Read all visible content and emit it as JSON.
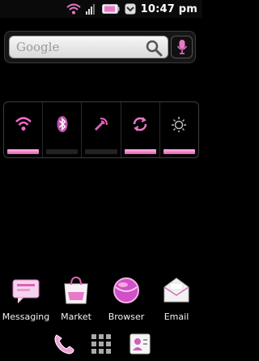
{
  "status_bar": {
    "time": "10:47 pm",
    "icons": [
      "wifi-icon",
      "signal-icon",
      "battery-icon",
      "notification-icon"
    ]
  },
  "search_widget": {
    "placeholder": "Google",
    "search_icon": "magnifier-icon",
    "voice_icon": "microphone-icon"
  },
  "power_widget": {
    "toggles": [
      {
        "name": "wifi",
        "icon": "wifi-icon",
        "on": true
      },
      {
        "name": "bluetooth",
        "icon": "bluetooth-icon",
        "on": false
      },
      {
        "name": "gps",
        "icon": "gps-icon",
        "on": false
      },
      {
        "name": "sync",
        "icon": "sync-icon",
        "on": true
      },
      {
        "name": "brightness",
        "icon": "brightness-icon",
        "on": true
      }
    ]
  },
  "apps": [
    {
      "label": "Messaging",
      "icon": "messaging-icon"
    },
    {
      "label": "Market",
      "icon": "market-icon"
    },
    {
      "label": "Browser",
      "icon": "browser-icon"
    },
    {
      "label": "Email",
      "icon": "email-icon"
    }
  ],
  "dock": [
    {
      "icon": "phone-icon"
    },
    {
      "icon": "app-drawer-icon"
    },
    {
      "icon": "contacts-icon"
    }
  ],
  "colors": {
    "accent": "#e878c8",
    "background": "#000000"
  }
}
